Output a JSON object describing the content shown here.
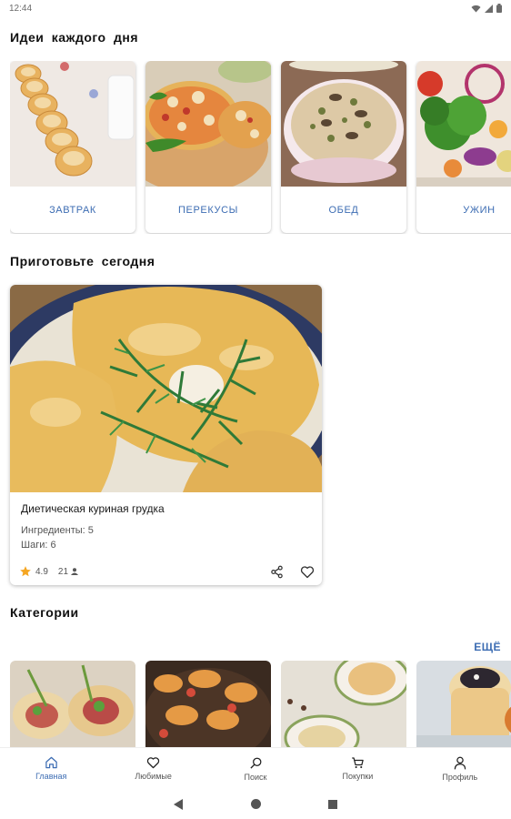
{
  "status_bar": {
    "time": "12:44"
  },
  "ideas": {
    "title": "Идеи каждого дня",
    "cards": [
      {
        "label": "ЗАВТРАК"
      },
      {
        "label": "ПЕРЕКУСЫ"
      },
      {
        "label": "ОБЕД"
      },
      {
        "label": "УЖИН"
      }
    ]
  },
  "today": {
    "title": "Приготовьте сегодня",
    "recipe": {
      "name": "Диетическая куриная грудка",
      "ingredients": "Ингредиенты: 5",
      "steps": "Шаги: 6",
      "rating": "4.9",
      "views": "21"
    }
  },
  "categories": {
    "title": "Категории",
    "more_label": "ЕЩЁ"
  },
  "bottom_nav": {
    "items": [
      {
        "label": "Главная",
        "icon": "home-icon",
        "active": true
      },
      {
        "label": "Любимые",
        "icon": "heart-icon",
        "active": false
      },
      {
        "label": "Поиск",
        "icon": "search-icon",
        "active": false
      },
      {
        "label": "Покупки",
        "icon": "cart-icon",
        "active": false
      },
      {
        "label": "Профиль",
        "icon": "profile-icon",
        "active": false
      }
    ]
  },
  "colors": {
    "accent": "#3d6db3",
    "star": "#f5a623"
  }
}
